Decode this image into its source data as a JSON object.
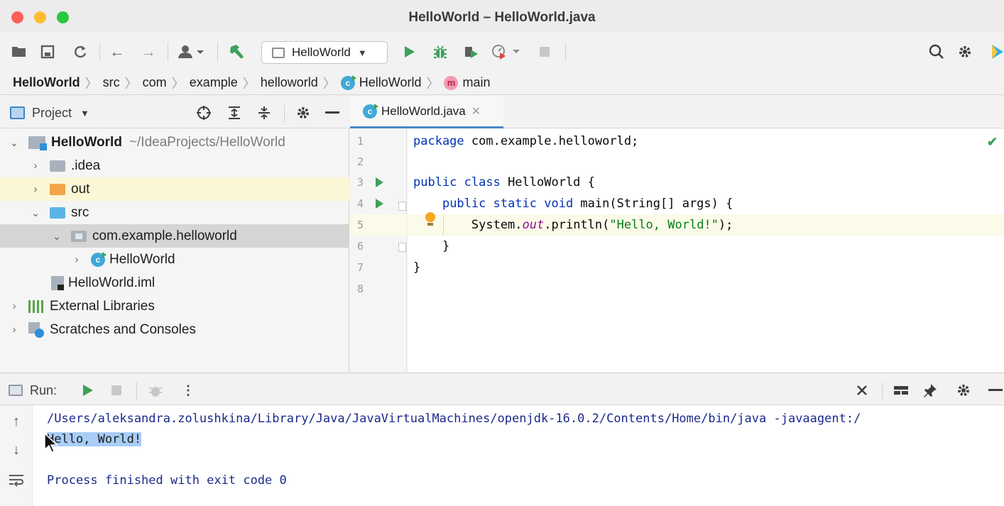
{
  "window": {
    "title": "HelloWorld – HelloWorld.java"
  },
  "toolbar": {
    "run_config": "HelloWorld"
  },
  "breadcrumbs": [
    "HelloWorld",
    "src",
    "com",
    "example",
    "helloworld",
    "HelloWorld",
    "main"
  ],
  "project_panel": {
    "title": "Project",
    "tree": [
      {
        "label": "HelloWorld",
        "hint": "~/IdeaProjects/HelloWorld"
      },
      {
        "label": ".idea"
      },
      {
        "label": "out"
      },
      {
        "label": "src"
      },
      {
        "label": "com.example.helloworld"
      },
      {
        "label": "HelloWorld"
      },
      {
        "label": "HelloWorld.iml"
      },
      {
        "label": "External Libraries"
      },
      {
        "label": "Scratches and Consoles"
      }
    ]
  },
  "editor": {
    "tab_label": "HelloWorld.java",
    "line_numbers": [
      "1",
      "2",
      "3",
      "4",
      "5",
      "6",
      "7",
      "8"
    ],
    "code": {
      "l1_kw": "package",
      "l1_rest": " com.example.helloworld;",
      "l3_kw": "public class",
      "l3_rest": " HelloWorld {",
      "l4_indent": "    ",
      "l4_kw": "public static void",
      "l4_rest": " main(String[] args) {",
      "l5_a": "        System.",
      "l5_field": "out",
      "l5_b": ".println(",
      "l5_str": "\"Hello, World!\"",
      "l5_c": ");",
      "l6": "    }",
      "l7": "}"
    }
  },
  "run_panel": {
    "title": "Run:",
    "output": [
      "/Users/aleksandra.zolushkina/Library/Java/JavaVirtualMachines/openjdk-16.0.2/Contents/Home/bin/java -javaagent:/",
      "Hello, World!",
      "",
      "Process finished with exit code 0"
    ]
  },
  "colors": {
    "accent": "#4a88c7",
    "run_green": "#3fa05a",
    "selection": "#a8cdf7"
  },
  "icons": [
    "folder-open-icon",
    "save-icon",
    "sync-icon",
    "back-icon",
    "forward-icon",
    "vcs-icon",
    "build-hammer-icon",
    "run-icon",
    "debug-icon",
    "coverage-icon",
    "profile-icon",
    "stop-icon",
    "search-icon",
    "settings-icon",
    "locate-icon",
    "expand-all-icon",
    "collapse-all-icon",
    "minimize-icon",
    "close-icon",
    "layout-icon",
    "pin-icon",
    "scroll-up-icon",
    "scroll-down-icon",
    "soft-wrap-icon",
    "lightbulb-icon",
    "check-icon"
  ]
}
